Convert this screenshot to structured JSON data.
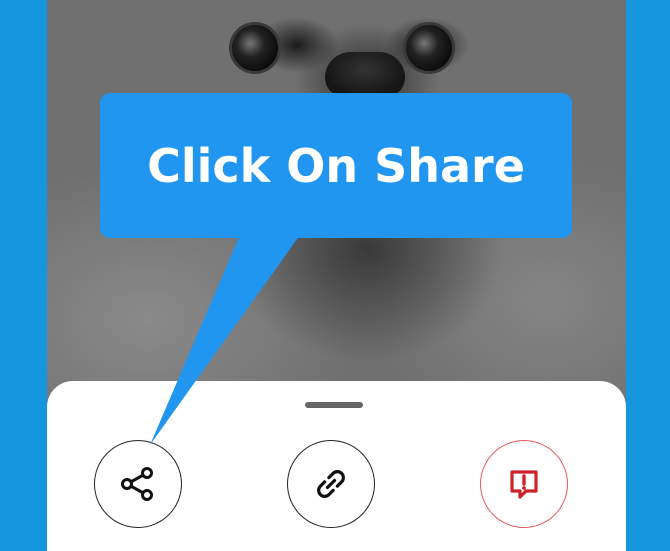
{
  "tooltip": {
    "text": "Click On Share",
    "color": "#2196f0"
  },
  "share_sheet": {
    "actions": [
      {
        "name": "share",
        "icon": "share-icon"
      },
      {
        "name": "copy-link",
        "icon": "link-icon"
      },
      {
        "name": "report",
        "icon": "report-icon",
        "color": "#d0222a"
      }
    ]
  },
  "colors": {
    "frame": "#1497dc",
    "sheet": "#ffffff"
  }
}
